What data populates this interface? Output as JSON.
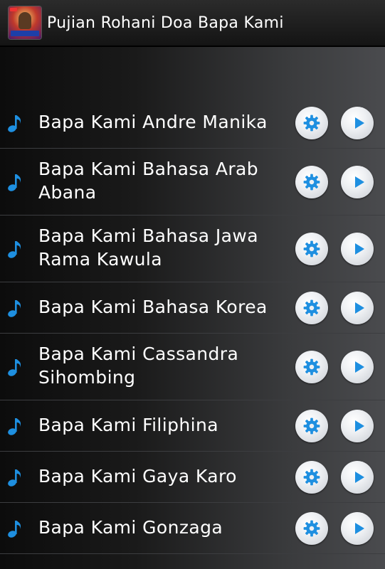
{
  "app": {
    "title": "Pujian Rohani Doa Bapa Kami",
    "icon": "app-logo-icon"
  },
  "colors": {
    "accent": "#1e8fe0",
    "text": "#ffffff",
    "titlebar": "#1c1c1c"
  },
  "songs": [
    {
      "label": "Bapa Kami Andre Manika",
      "icon": "music-note-icon"
    },
    {
      "label": "Bapa Kami Bahasa Arab Abana",
      "icon": "music-note-icon"
    },
    {
      "label": "Bapa Kami Bahasa Jawa Rama Kawula",
      "icon": "music-note-icon"
    },
    {
      "label": "Bapa Kami Bahasa Korea",
      "icon": "music-note-icon"
    },
    {
      "label": "Bapa Kami Cassandra Sihombing",
      "icon": "music-note-icon"
    },
    {
      "label": "Bapa Kami Filiphina",
      "icon": "music-note-icon"
    },
    {
      "label": "Bapa Kami Gaya Karo",
      "icon": "music-note-icon"
    },
    {
      "label": "Bapa Kami Gonzaga",
      "icon": "music-note-icon"
    }
  ],
  "row_actions": {
    "settings_icon": "gear-icon",
    "play_icon": "play-icon"
  }
}
